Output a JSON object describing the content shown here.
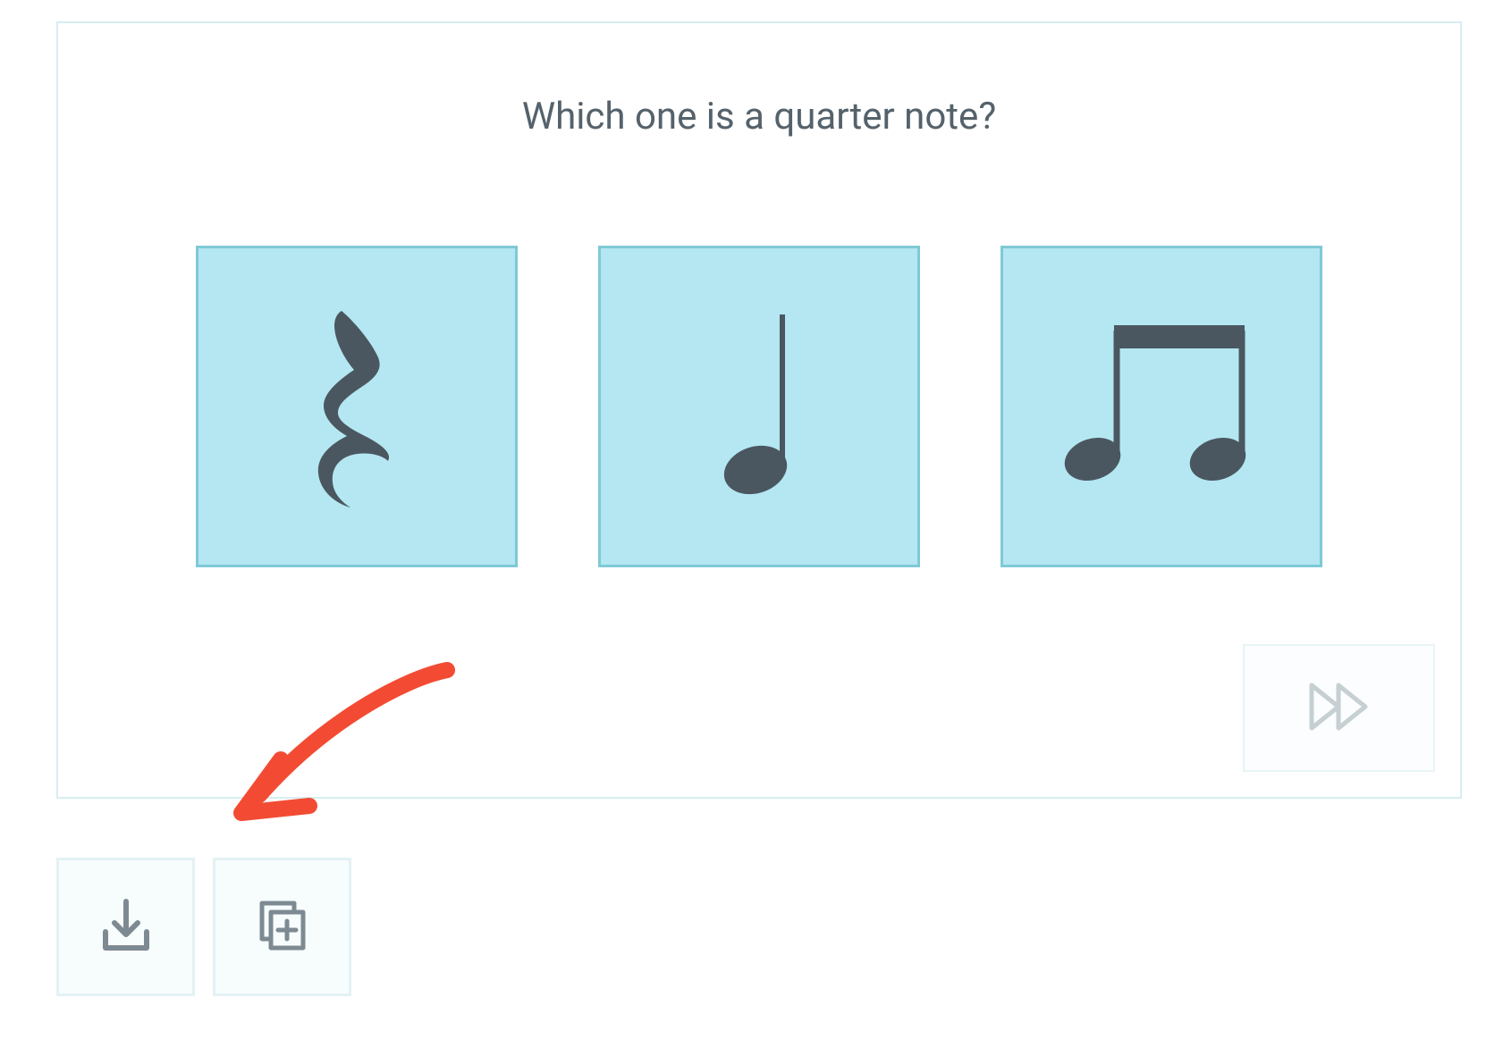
{
  "quiz": {
    "question": "Which one is a quarter note?",
    "options": [
      {
        "icon_name": "quarter-rest-icon"
      },
      {
        "icon_name": "quarter-note-icon"
      },
      {
        "icon_name": "beamed-eighth-notes-icon"
      }
    ],
    "skip_icon": "fast-forward-icon"
  },
  "actions": {
    "download_icon": "download-icon",
    "duplicate_icon": "duplicate-add-icon"
  },
  "annotation": {
    "arrow": "red-arrow-annotation"
  },
  "colors": {
    "panel_border": "#d7eef1",
    "option_bg": "#b4e7f2",
    "option_border": "#7fc9d6",
    "text": "#55626b",
    "note_fill": "#4b5760",
    "action_border": "#e3f2f4",
    "action_bg": "#f7fcfd",
    "skip_stroke": "#c6cfd2",
    "arrow": "#f34b33"
  }
}
